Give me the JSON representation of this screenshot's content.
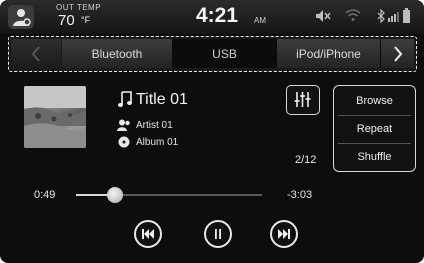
{
  "status_bar": {
    "outside_temp_label": "OUT TEMP",
    "outside_temp_value": "70",
    "outside_temp_unit": "°F",
    "time": "4:21",
    "ampm": "AM",
    "icons": [
      "profile-icon",
      "mute-icon",
      "wifi-icon",
      "bluetooth-icon",
      "signal-icon",
      "battery-icon"
    ]
  },
  "source_tabs": {
    "items": [
      {
        "label": "Bluetooth",
        "active": false
      },
      {
        "label": "USB",
        "active": true
      },
      {
        "label": "iPod/iPhone",
        "active": false
      }
    ],
    "prev_icon": "chevron-left-icon",
    "next_icon": "chevron-right-icon"
  },
  "now_playing": {
    "title": "Title 01",
    "artist": "Artist 01",
    "album": "Album 01",
    "track_index": "2/12",
    "elapsed": "0:49",
    "remaining": "-3:03",
    "progress_fraction": 0.21
  },
  "side_menu": {
    "browse": "Browse",
    "repeat": "Repeat",
    "shuffle": "Shuffle"
  },
  "controls": {
    "prev": "skip-previous-icon",
    "pause": "pause-icon",
    "next": "skip-next-icon"
  },
  "colors": {
    "background": "#0d0d0d",
    "text": "#f0f0f0",
    "accent_border": "#d8d8d8"
  }
}
